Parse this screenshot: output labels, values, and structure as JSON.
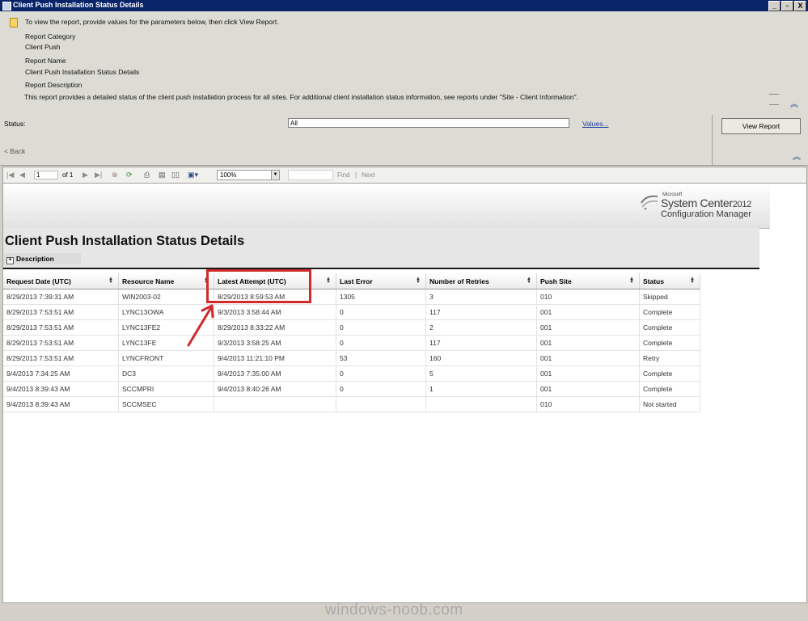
{
  "window": {
    "title": "Client Push Installation Status Details",
    "controls": [
      "_",
      "▫",
      "X"
    ]
  },
  "info": {
    "instruction": "To view the report, provide values for the parameters below, then click View Report.",
    "category_label": "Report Category",
    "category_value": "Client Push",
    "name_label": "Report Name",
    "name_value": "Client Push Installation Status Details",
    "description_label": "Report Description",
    "description_value": "This report provides a detailed status of the client push installation process for all sites. For additional client installation status information, see reports under \"Site - Client Information\"."
  },
  "params": {
    "status_label": "Status:",
    "status_value": "All",
    "values_link": "Values...",
    "view_report": "View Report",
    "back": "< Back"
  },
  "toolbar": {
    "page": "1",
    "of_pages": "of 1",
    "zoom": "100%",
    "find": "Find",
    "sep": "|",
    "next": "Next"
  },
  "logo": {
    "microsoft": "Microsoft",
    "product": "System Center",
    "year": "2012",
    "sub": "Configuration Manager"
  },
  "report": {
    "title": "Client Push Installation Status Details",
    "description_toggle": "Description"
  },
  "table": {
    "columns": [
      "Request Date (UTC)",
      "Resource Name",
      "Latest Attempt (UTC)",
      "Last Error",
      "Number of Retries",
      "Push Site",
      "Status"
    ],
    "rows": [
      [
        "8/29/2013 7:39:31 AM",
        "WIN2003-02",
        "8/29/2013 8:59:53 AM",
        "1305",
        "3",
        "010",
        "Skipped"
      ],
      [
        "8/29/2013 7:53:51 AM",
        "LYNC13OWA",
        "9/3/2013 3:58:44 AM",
        "0",
        "117",
        "001",
        "Complete"
      ],
      [
        "8/29/2013 7:53:51 AM",
        "LYNC13FE2",
        "8/29/2013 8:33:22 AM",
        "0",
        "2",
        "001",
        "Complete"
      ],
      [
        "8/29/2013 7:53:51 AM",
        "LYNC13FE",
        "9/3/2013 3:58:25 AM",
        "0",
        "117",
        "001",
        "Complete"
      ],
      [
        "8/29/2013 7:53:51 AM",
        "LYNCFRONT",
        "9/4/2013 11:21:10 PM",
        "53",
        "160",
        "001",
        "Retry"
      ],
      [
        "9/4/2013 7:34:25 AM",
        "DC3",
        "9/4/2013 7:35:00 AM",
        "0",
        "5",
        "001",
        "Complete"
      ],
      [
        "9/4/2013 8:39:43 AM",
        "SCCMPRI",
        "9/4/2013 8:40:26 AM",
        "0",
        "1",
        "001",
        "Complete"
      ],
      [
        "9/4/2013 8:39:43 AM",
        "SCCMSEC",
        "",
        "",
        "",
        "010",
        "Not started"
      ]
    ]
  },
  "watermark": "windows-noob.com",
  "colors": {
    "annotation": "#d12a2a",
    "title_bar": "#0a246a",
    "link": "#1a3fa0"
  }
}
